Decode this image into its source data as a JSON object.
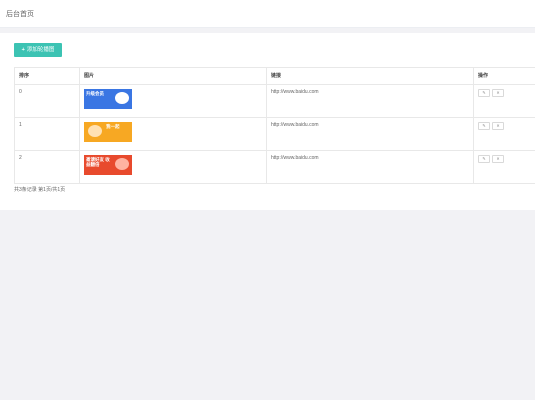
{
  "header": {
    "title": "后台首页"
  },
  "toolbar": {
    "add_label": "添加轮播图"
  },
  "table": {
    "columns": [
      "排序",
      "图片",
      "链接",
      "操作"
    ],
    "rows": [
      {
        "order": "0",
        "image_caption": "升级会员",
        "image_colors": [
          "#3a76e3",
          "#ffffff"
        ],
        "link": "http://www.baidu.com"
      },
      {
        "order": "1",
        "image_caption": "我一起",
        "image_colors": [
          "#f7a823",
          "#ffe1b3"
        ],
        "link": "http://www.baidu.com"
      },
      {
        "order": "2",
        "image_caption": "邀请好友 收益翻倍",
        "image_colors": [
          "#e84a2d",
          "#ffb3a1"
        ],
        "link": "http://www.baidu.com"
      }
    ],
    "actions": {
      "edit_icon": "pencil-icon",
      "delete_icon": "close-icon"
    }
  },
  "pagination": {
    "summary": "共3条记录 第1页/共1页"
  },
  "colors": {
    "accent": "#3cc3b3"
  }
}
